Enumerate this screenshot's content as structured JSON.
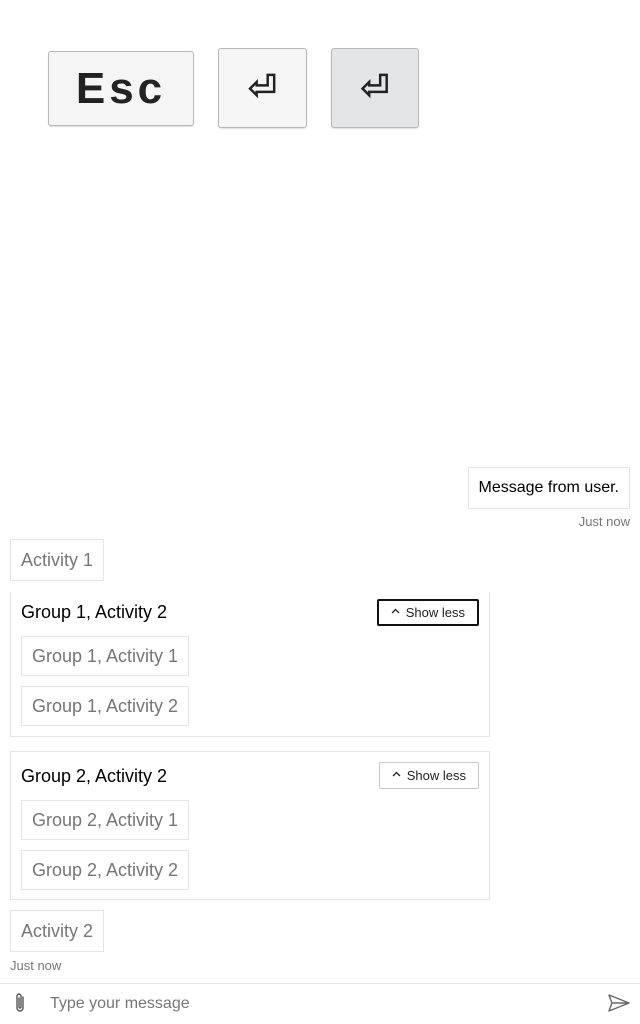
{
  "keys": {
    "esc_label": "Esc",
    "enter_glyph": "⏎",
    "enter_glyph_2": "⏎"
  },
  "transcript": {
    "user_message": "Message from user.",
    "user_timestamp": "Just now",
    "activity_1": "Activity 1",
    "groups": [
      {
        "header": "Group 1, Activity 2",
        "toggle_label": "Show less",
        "items": [
          "Group 1, Activity 1",
          "Group 1, Activity 2"
        ]
      },
      {
        "header": "Group 2, Activity 2",
        "toggle_label": "Show less",
        "items": [
          "Group 2, Activity 1",
          "Group 2, Activity 2"
        ]
      }
    ],
    "activity_2": "Activity 2",
    "bot_timestamp": "Just now"
  },
  "composer": {
    "placeholder": "Type your message",
    "value": ""
  },
  "icons": {
    "attach": "paperclip-icon",
    "send": "send-icon",
    "chevron": "chevron-up-icon"
  },
  "colors": {
    "border": "#e4e4e4",
    "muted_text": "#767676",
    "focus_outline": "#111111",
    "pressed_key": "#e3e5e8"
  }
}
